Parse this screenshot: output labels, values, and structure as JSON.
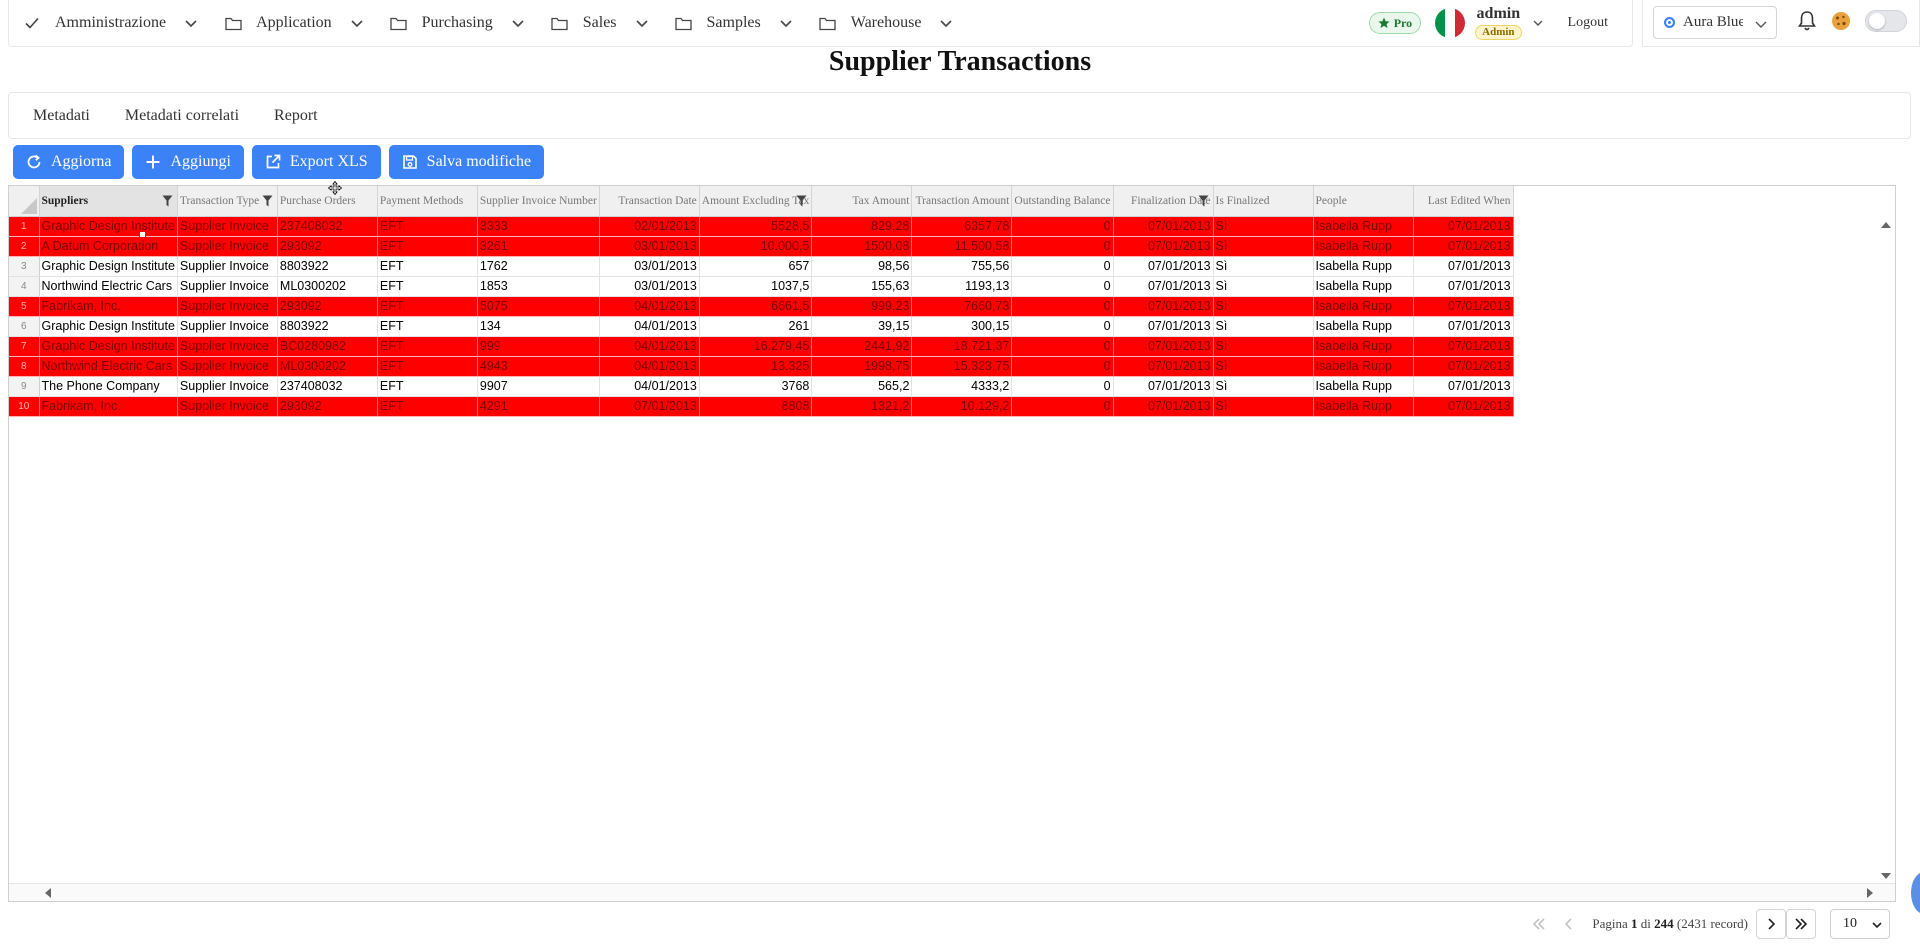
{
  "nav": {
    "items": [
      {
        "label": "Amministrazione",
        "icon": "check-icon"
      },
      {
        "label": "Application",
        "icon": "folder-icon"
      },
      {
        "label": "Purchasing",
        "icon": "folder-icon"
      },
      {
        "label": "Sales",
        "icon": "folder-icon"
      },
      {
        "label": "Samples",
        "icon": "folder-icon"
      },
      {
        "label": "Warehouse",
        "icon": "folder-icon"
      }
    ],
    "pro_badge": "Pro",
    "user_name": "admin",
    "user_role": "Admin",
    "logout": "Logout",
    "theme_label": "Aura Blue"
  },
  "page": {
    "title": "Supplier Transactions"
  },
  "tabs": [
    "Metadati",
    "Metadati correlati",
    "Report"
  ],
  "toolbar": {
    "refresh": "Aggiorna",
    "add": "Aggiungi",
    "export": "Export XLS",
    "save": "Salva modifiche"
  },
  "grid": {
    "columns": [
      "Suppliers",
      "Transaction Type",
      "Purchase Orders",
      "Payment Methods",
      "Supplier Invoice Number",
      "Transaction Date",
      "Amount Excluding Tax",
      "Tax Amount",
      "Transaction Amount",
      "Outstanding Balance",
      "Finalization Date",
      "Is Finalized",
      "People",
      "Last Edited When"
    ],
    "rows": [
      {
        "n": "1",
        "cells": [
          "Graphic Design Institute",
          "Supplier Invoice",
          "237408032",
          "EFT",
          "3333",
          "02/01/2013",
          "5528,5",
          "829,28",
          "6357,78",
          "0",
          "07/01/2013",
          "Sì",
          "Isabella Rupp",
          "07/01/2013"
        ],
        "alert": true
      },
      {
        "n": "2",
        "cells": [
          "A Datum Corporation",
          "Supplier Invoice",
          "293092",
          "EFT",
          "3261",
          "03/01/2013",
          "10.000,5",
          "1500,08",
          "11.500,58",
          "0",
          "07/01/2013",
          "Sì",
          "Isabella Rupp",
          "07/01/2013"
        ],
        "alert": true
      },
      {
        "n": "3",
        "cells": [
          "Graphic Design Institute",
          "Supplier Invoice",
          "8803922",
          "EFT",
          "1762",
          "03/01/2013",
          "657",
          "98,56",
          "755,56",
          "0",
          "07/01/2013",
          "Sì",
          "Isabella Rupp",
          "07/01/2013"
        ],
        "alert": false
      },
      {
        "n": "4",
        "cells": [
          "Northwind Electric Cars",
          "Supplier Invoice",
          "ML0300202",
          "EFT",
          "1853",
          "03/01/2013",
          "1037,5",
          "155,63",
          "1193,13",
          "0",
          "07/01/2013",
          "Sì",
          "Isabella Rupp",
          "07/01/2013"
        ],
        "alert": false
      },
      {
        "n": "5",
        "cells": [
          "Fabrikam, Inc.",
          "Supplier Invoice",
          "293092",
          "EFT",
          "5075",
          "04/01/2013",
          "6661,5",
          "999,23",
          "7660,73",
          "0",
          "07/01/2013",
          "Sì",
          "Isabella Rupp",
          "07/01/2013"
        ],
        "alert": true
      },
      {
        "n": "6",
        "cells": [
          "Graphic Design Institute",
          "Supplier Invoice",
          "8803922",
          "EFT",
          "134",
          "04/01/2013",
          "261",
          "39,15",
          "300,15",
          "0",
          "07/01/2013",
          "Sì",
          "Isabella Rupp",
          "07/01/2013"
        ],
        "alert": false
      },
      {
        "n": "7",
        "cells": [
          "Graphic Design Institute",
          "Supplier Invoice",
          "BC0280982",
          "EFT",
          "999",
          "04/01/2013",
          "16.279,45",
          "2441,92",
          "18.721,37",
          "0",
          "07/01/2013",
          "Sì",
          "Isabella Rupp",
          "07/01/2013"
        ],
        "alert": true
      },
      {
        "n": "8",
        "cells": [
          "Northwind Electric Cars",
          "Supplier Invoice",
          "ML0300202",
          "EFT",
          "4943",
          "04/01/2013",
          "13.325",
          "1998,75",
          "15.323,75",
          "0",
          "07/01/2013",
          "Sì",
          "Isabella Rupp",
          "07/01/2013"
        ],
        "alert": true
      },
      {
        "n": "9",
        "cells": [
          "The Phone Company",
          "Supplier Invoice",
          "237408032",
          "EFT",
          "9907",
          "04/01/2013",
          "3768",
          "565,2",
          "4333,2",
          "0",
          "07/01/2013",
          "Sì",
          "Isabella Rupp",
          "07/01/2013"
        ],
        "alert": false
      },
      {
        "n": "10",
        "cells": [
          "Fabrikam, Inc.",
          "Supplier Invoice",
          "293092",
          "EFT",
          "4291",
          "07/01/2013",
          "8808",
          "1321,2",
          "10.129,2",
          "0",
          "07/01/2013",
          "Sì",
          "Isabella Rupp",
          "07/01/2013"
        ],
        "alert": true
      }
    ]
  },
  "pagination": {
    "page_word": "Pagina",
    "current": "1",
    "of_word": "di",
    "total_pages": "244",
    "records": "(2431 record)",
    "page_size": "10"
  },
  "colors": {
    "primary": "#3b82f6",
    "alert_row": "#ff0000",
    "pro_green": "#1d7a34"
  }
}
